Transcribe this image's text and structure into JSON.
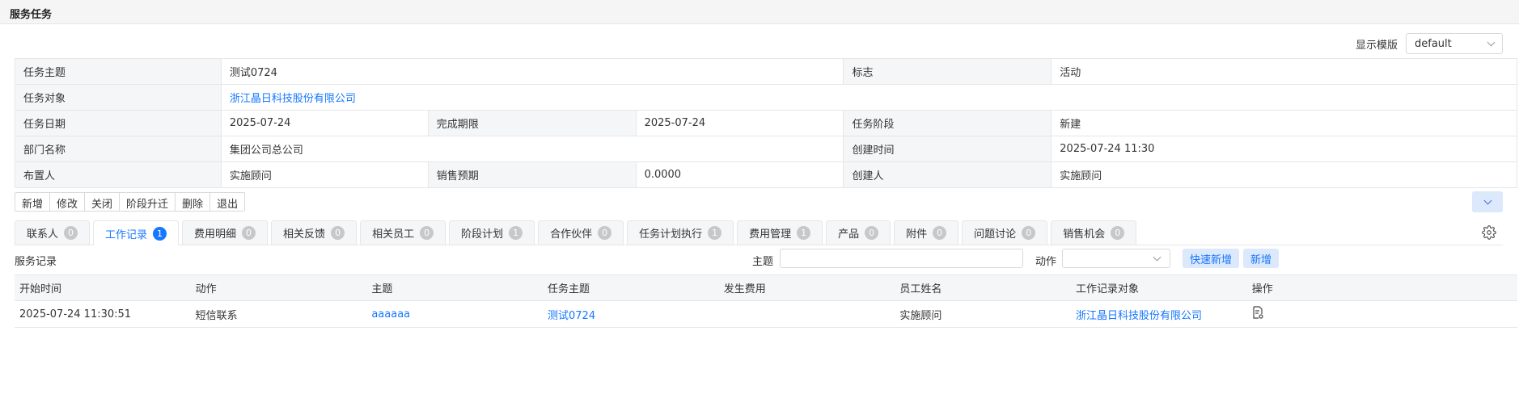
{
  "page_title": "服务任务",
  "template": {
    "label": "显示模版",
    "value": "default"
  },
  "info": {
    "r1": {
      "l1": "任务主题",
      "v1": "测试0724",
      "l2": "标志",
      "v2": "活动"
    },
    "r2": {
      "l1": "任务对象",
      "v1": "浙江晶日科技股份有限公司"
    },
    "r3": {
      "l1": "任务日期",
      "v1": "2025-07-24",
      "l2": "完成期限",
      "v2": "2025-07-24",
      "l3": "任务阶段",
      "v3": "新建"
    },
    "r4": {
      "l1": "部门名称",
      "v1": "集团公司总公司",
      "l2": "创建时间",
      "v2": "2025-07-24 11:30"
    },
    "r5": {
      "l1": "布置人",
      "v1": "实施顾问",
      "l2": "销售预期",
      "v2": "0.0000",
      "l3": "创建人",
      "v3": "实施顾问"
    }
  },
  "toolbar": {
    "buttons": [
      "新增",
      "修改",
      "关闭",
      "阶段升迁",
      "删除",
      "退出"
    ]
  },
  "tabs": [
    {
      "label": "联系人",
      "count": "0"
    },
    {
      "label": "工作记录",
      "count": "1"
    },
    {
      "label": "费用明细",
      "count": "0"
    },
    {
      "label": "相关反馈",
      "count": "0"
    },
    {
      "label": "相关员工",
      "count": "0"
    },
    {
      "label": "阶段计划",
      "count": "1"
    },
    {
      "label": "合作伙伴",
      "count": "0"
    },
    {
      "label": "任务计划执行",
      "count": "1"
    },
    {
      "label": "费用管理",
      "count": "1"
    },
    {
      "label": "产品",
      "count": "0"
    },
    {
      "label": "附件",
      "count": "0"
    },
    {
      "label": "问题讨论",
      "count": "0"
    },
    {
      "label": "销售机会",
      "count": "0"
    }
  ],
  "records": {
    "title": "服务记录",
    "filter_theme_label": "主题",
    "filter_action_label": "动作",
    "quick_add_label": "快速新增",
    "add_label": "新增",
    "columns": [
      "开始时间",
      "动作",
      "主题",
      "任务主题",
      "发生费用",
      "员工姓名",
      "工作记录对象",
      "操作"
    ],
    "rows": [
      {
        "start": "2025-07-24 11:30:51",
        "action": "短信联系",
        "theme": "aaaaaa",
        "task": "测试0724",
        "cost": "",
        "employee": "实施顾问",
        "target": "浙江晶日科技股份有限公司"
      }
    ]
  },
  "colors": {
    "accent": "#1677ff",
    "label_bg": "#f5f6f8",
    "border": "#e6e6e6"
  }
}
